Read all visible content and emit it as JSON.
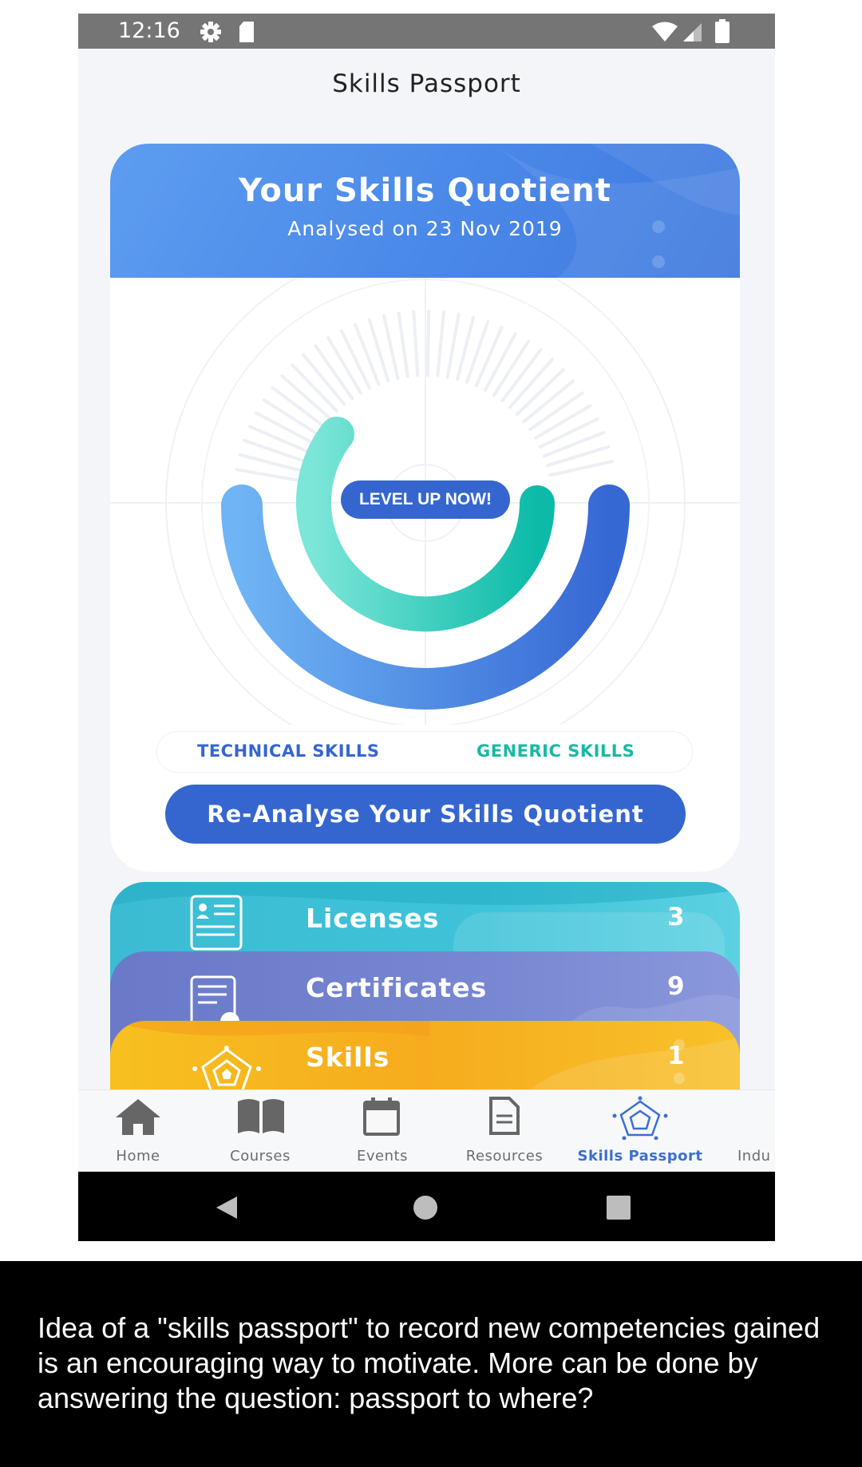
{
  "status_bar": {
    "time": "12:16",
    "icons": [
      "settings-icon",
      "sd-card-icon",
      "wifi-icon",
      "signal-icon",
      "battery-icon"
    ]
  },
  "header": {
    "title": "Skills Passport"
  },
  "skills_quotient": {
    "title": "Your Skills Quotient",
    "subtitle": "Analysed on 23 Nov 2019",
    "level_up_label": "LEVEL UP NOW!",
    "legend": {
      "technical": "TECHNICAL SKILLS",
      "generic": "GENERIC SKILLS"
    },
    "reanalyse_label": "Re-Analyse Your Skills Quotient",
    "colors": {
      "technical": "#3566d0",
      "generic": "#19b9a6"
    }
  },
  "summary_cards": [
    {
      "label": "Licenses",
      "count": "3",
      "icon": "license-icon",
      "color": "#3fc3d9"
    },
    {
      "label": "Certificates",
      "count": "9",
      "icon": "certificate-icon",
      "color": "#7787d1"
    },
    {
      "label": "Skills",
      "count": "1",
      "icon": "skills-radar-icon",
      "color": "#f7b520"
    }
  ],
  "bottom_nav": {
    "items": [
      {
        "label": "Home",
        "icon": "home-icon",
        "active": false
      },
      {
        "label": "Courses",
        "icon": "book-icon",
        "active": false
      },
      {
        "label": "Events",
        "icon": "calendar-icon",
        "active": false
      },
      {
        "label": "Resources",
        "icon": "document-icon",
        "active": false
      },
      {
        "label": "Skills Passport",
        "icon": "skills-radar-icon",
        "active": true
      },
      {
        "label": "Indu",
        "icon": "",
        "active": false
      }
    ]
  },
  "android_nav": {
    "icons": [
      "back-icon",
      "home-circle-icon",
      "recents-icon"
    ]
  },
  "caption": {
    "text": "Idea of a \"skills passport\" to record new competencies gained is an encouraging way to motivate. More can be done by answering the question: passport to where?"
  }
}
